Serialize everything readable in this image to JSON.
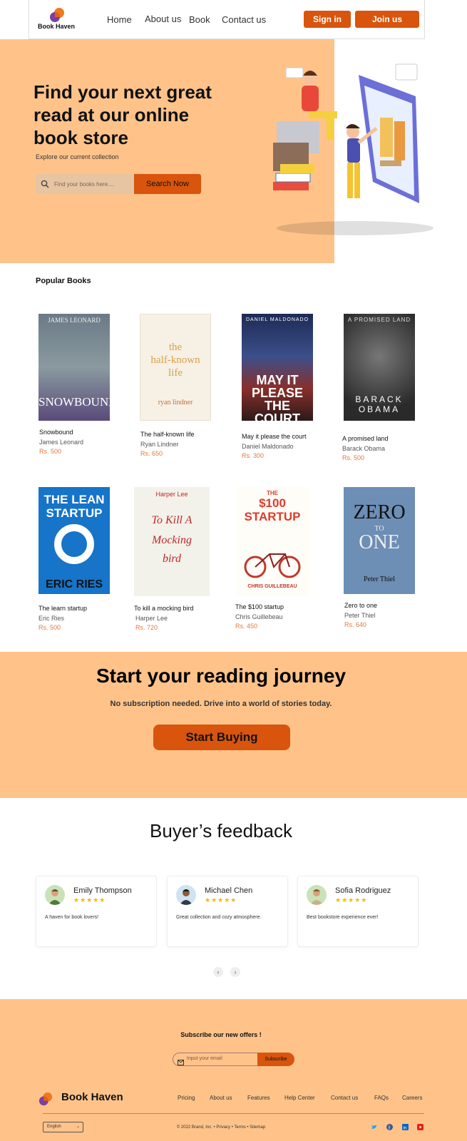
{
  "brand": {
    "name": "Book Haven"
  },
  "nav": {
    "links": [
      "Home",
      "About us",
      "Book",
      "Contact us"
    ],
    "signin": "Sign in",
    "joinus": "Join us"
  },
  "hero": {
    "title": "Find your next great read at our online book store",
    "subtitle": "Explore our current collection",
    "search_placeholder": "Find your books here....",
    "search_button": "Search Now"
  },
  "popular": {
    "title": "Popular Books",
    "books": [
      {
        "title": "Snowbound",
        "author": "James Leonard",
        "price": "Rs. 500"
      },
      {
        "title": "The half-known life",
        "author": "Ryan Lindner",
        "price": "Rs. 650"
      },
      {
        "title": "May it please the court",
        "author": "Daniel Maldonado",
        "price": "Rs. 300"
      },
      {
        "title": "A promised land",
        "author": "Barack Obama",
        "price": "Rs. 500"
      },
      {
        "title": "The learn startup",
        "author": "Eric Ries",
        "price": "Rs. 500"
      },
      {
        "title": "To kill a mocking bird",
        "author": "Harper Lee",
        "price": "Rs. 720"
      },
      {
        "title": "The $100 startup",
        "author": "Chris Guillebeau",
        "price": "Rs. 450"
      },
      {
        "title": "Zero to one",
        "author": "Peter Thiel",
        "price": "Rs. 640"
      }
    ]
  },
  "covers": {
    "c1a": "JAMES LEONARD",
    "c1b": "SNOWBOUND",
    "c2a": "the",
    "c2b": "half-known",
    "c2c": "life",
    "c2d": "ryan lindner",
    "c3a": "DANIEL MALDONADO",
    "c3b": "MAY IT",
    "c3c": "PLEASE",
    "c3d": "THE COURT",
    "c4a": "A PROMISED LAND",
    "c4b": "BARACK",
    "c4c": "OBAMA",
    "c5a": "THE LEAN",
    "c5b": "STARTUP",
    "c5c": "ERIC RIES",
    "c6a": "Harper Lee",
    "c6b": "To Kill A",
    "c6c": "Mocking",
    "c6d": "bird",
    "c7a": "THE",
    "c7b": "$100",
    "c7c": "STARTUP",
    "c7d": "CHRIS GUILLEBEAU",
    "c8a": "ZERO",
    "c8b": "TO",
    "c8c": "ONE",
    "c8d": "Peter Thiel"
  },
  "cta": {
    "title": "Start your reading journey",
    "subtitle": "No subscription needed. Drive into a world of stories today.",
    "button": "Start Buying"
  },
  "feedback": {
    "title": "Buyer’s feedback",
    "cards": [
      {
        "name": "Emily Thompson",
        "stars": "★★★★★",
        "text": "A haven for book lovers!"
      },
      {
        "name": "Michael Chen",
        "stars": "★★★★★",
        "text": "Great collection and cozy atmosphere."
      },
      {
        "name": "Sofia Rodriguez",
        "stars": "★★★★★",
        "text": "Best bookstore experience ever!"
      }
    ],
    "prev": "‹",
    "next": "›"
  },
  "footer": {
    "subscribe_title": "Subscribe our new offers !",
    "email_placeholder": "Input your email",
    "subscribe_button": "Subscribe",
    "links": [
      "Pricing",
      "About us",
      "Features",
      "Help Center",
      "Contact us",
      "FAQs",
      "Careers"
    ],
    "language": "English",
    "copyright": "© 2022 Brand, Inc. • Privacy • Terms • Sitemap"
  },
  "colors": {
    "accent": "#d9540c",
    "peach": "#ffc38a",
    "price": "#e07a3a"
  }
}
